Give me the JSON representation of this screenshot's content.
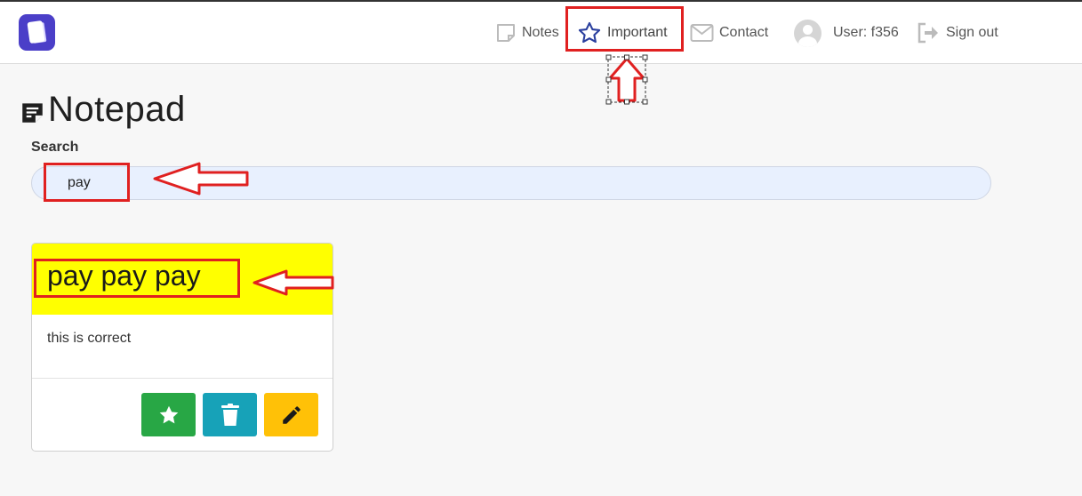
{
  "navbar": {
    "items": {
      "notes": "Notes",
      "important": "Important",
      "contact": "Contact",
      "user": "User: f356",
      "signout": "Sign out"
    }
  },
  "page": {
    "title": "Notepad"
  },
  "search": {
    "label": "Search",
    "value": "pay"
  },
  "notes": [
    {
      "title": "pay pay pay",
      "body": "this is correct",
      "header_color": "#ffff00",
      "actions": [
        "star-icon",
        "trash-icon",
        "pencil-icon"
      ]
    }
  ],
  "colors": {
    "brand": "#4b3fc8",
    "important_star": "#2a3f9e",
    "annotation": "#e02020",
    "star_button": "#28a745",
    "trash_button": "#17a2b8",
    "edit_button": "#ffc107"
  }
}
